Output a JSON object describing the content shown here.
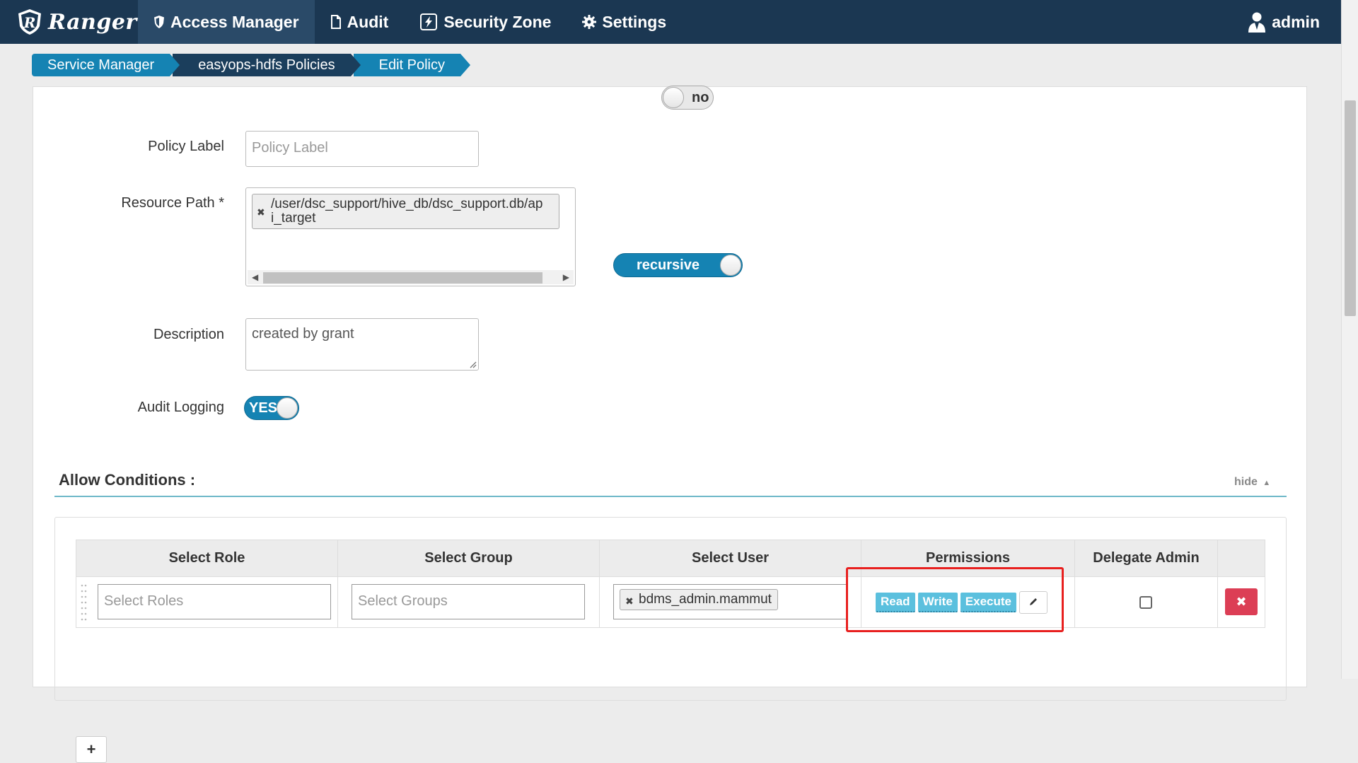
{
  "nav": {
    "brand": "Ranger",
    "items": [
      {
        "label": "Access Manager",
        "icon": "shield-icon"
      },
      {
        "label": "Audit",
        "icon": "file-icon"
      },
      {
        "label": "Security Zone",
        "icon": "lightning-icon"
      },
      {
        "label": "Settings",
        "icon": "gear-icon"
      }
    ],
    "user": "admin"
  },
  "breadcrumb": [
    "Service Manager",
    "easyops-hdfs Policies",
    "Edit Policy"
  ],
  "form": {
    "top_toggle_label": "no",
    "policy_label": {
      "label": "Policy Label",
      "placeholder": "Policy Label"
    },
    "resource_path": {
      "label": "Resource Path *",
      "tag_line1": "/user/dsc_support/hive_db/dsc_support.db/ap",
      "tag_line2": "i_target",
      "recursive_label": "recursive"
    },
    "description": {
      "label": "Description",
      "value": "created by grant"
    },
    "audit_logging": {
      "label": "Audit Logging",
      "toggle_label": "YES"
    }
  },
  "allow_conditions": {
    "title": "Allow Conditions :",
    "hide_label": "hide",
    "columns": [
      "Select Role",
      "Select Group",
      "Select User",
      "Permissions",
      "Delegate Admin",
      ""
    ],
    "row": {
      "roles_placeholder": "Select Roles",
      "groups_placeholder": "Select Groups",
      "user_tag": "bdms_admin.mammut",
      "permissions": [
        "Read",
        "Write",
        "Execute"
      ]
    },
    "add_label": "+"
  }
}
